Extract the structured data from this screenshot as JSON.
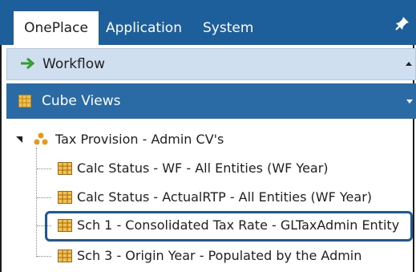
{
  "tabs": {
    "oneplace": "OnePlace",
    "application": "Application",
    "system": "System"
  },
  "workflow": {
    "label": "Workflow"
  },
  "cube_views": {
    "label": "Cube Views"
  },
  "tree": {
    "root": "Tax Provision - Admin CV's",
    "items": [
      "Calc Status - WF - All Entities (WF Year)",
      "Calc Status - ActualRTP - All Entities (WF Year)",
      "Sch 1 - Consolidated Tax Rate - GLTaxAdmin Entity",
      "Sch 3 - Origin Year - Populated by the Admin"
    ],
    "selected_index": 2
  },
  "colors": {
    "tabbar": "#1d5f9b",
    "workflow_header": "#d0dff0",
    "cubeviews_header": "#2a6aa5",
    "selection_border": "#1e5a92"
  },
  "icons": {
    "workflow": "green-arrow-icon",
    "cube_views": "grid-table-icon",
    "root": "cube-hierarchy-icon",
    "item": "cube-view-grid-icon",
    "pin": "pin-icon"
  }
}
